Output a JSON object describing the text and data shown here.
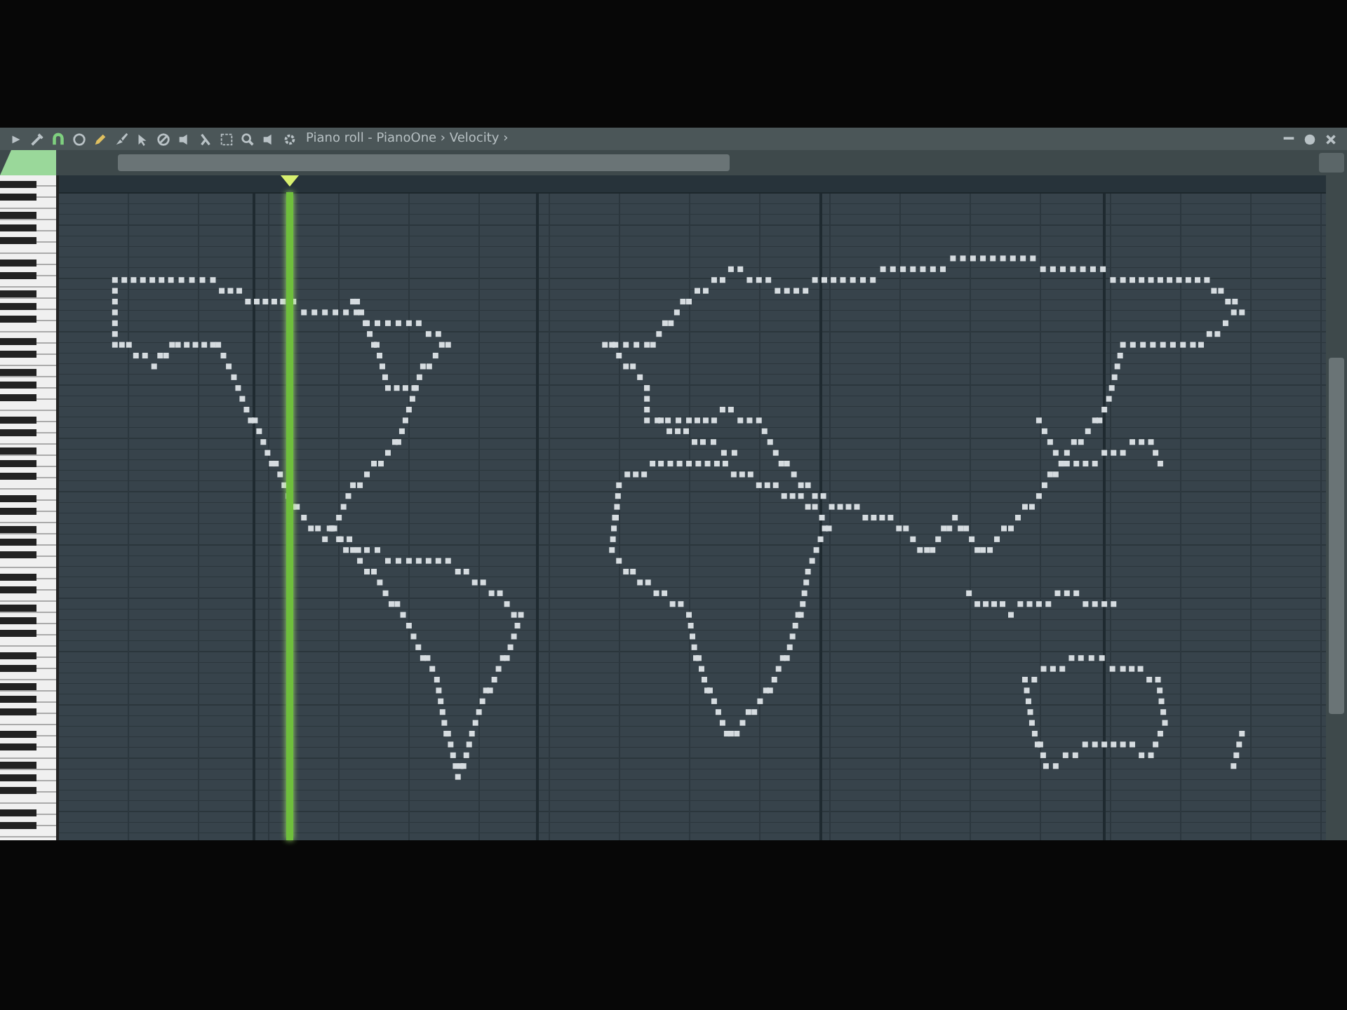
{
  "window": {
    "title": "Piano roll - PianoOne › Velocity ›"
  }
}
